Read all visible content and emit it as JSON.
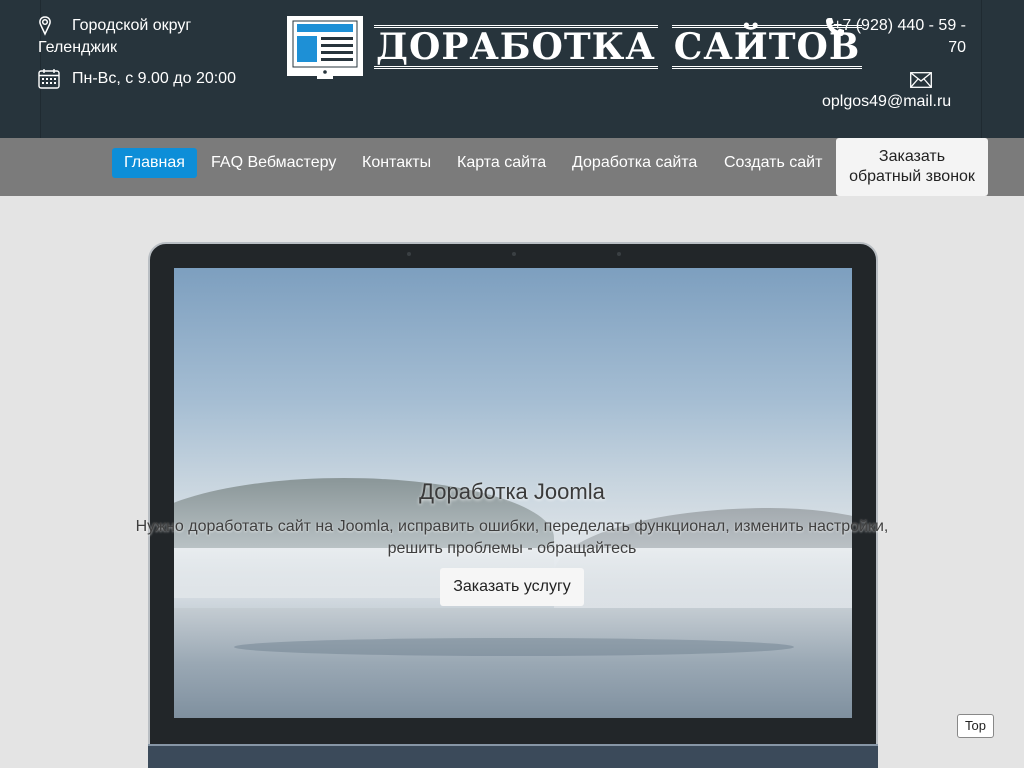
{
  "header": {
    "address": "Городской округ Геленджик",
    "hours": "Пн-Вс, с 9.00 до 20:00",
    "phone": "+7 (928) 440 - 59 - 70",
    "email": "oplgos49@mail.ru",
    "logo": {
      "word1": "ДОРАБОТКА",
      "word2": "САЙТОВ"
    },
    "icons": [
      "location-pin-icon",
      "calendar-icon",
      "phone-icon",
      "envelope-icon",
      "monitor-logo-icon"
    ]
  },
  "nav": {
    "items": [
      {
        "label": "Главная",
        "active": true
      },
      {
        "label": "FAQ Вебмастеру"
      },
      {
        "label": "Контакты"
      },
      {
        "label": "Карта сайта"
      },
      {
        "label": "Доработка сайта"
      },
      {
        "label": "Создать сайт"
      }
    ],
    "callback_line1": "Заказать",
    "callback_line2": "обратный звонок"
  },
  "hero": {
    "title": "Доработка Joomla",
    "text": "Нужно доработать сайт на Joomla, исправить ошибки, переделать функционал, изменить настройки, решить проблемы - обращайтесь",
    "button": "Заказать услугу"
  },
  "top_button": "Top",
  "colors": {
    "header_bg": "#27343c",
    "nav_bg": "#7b7b7b",
    "nav_active": "#0d8ed8",
    "logo_blue": "#1e90d6"
  }
}
